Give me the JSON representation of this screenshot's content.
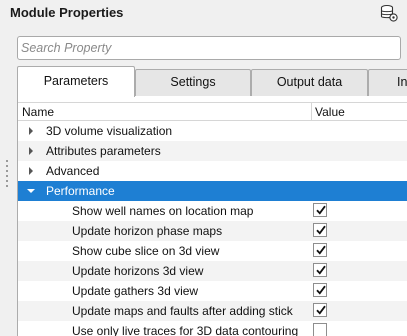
{
  "header": {
    "title": "Module Properties",
    "icon": "database-settings-icon"
  },
  "search": {
    "placeholder": "Search Property",
    "value": ""
  },
  "tabs": [
    {
      "label": "Parameters",
      "active": true
    },
    {
      "label": "Settings",
      "active": false
    },
    {
      "label": "Output data",
      "active": false
    },
    {
      "label": "Inf",
      "active": false
    }
  ],
  "table": {
    "columns": {
      "name": "Name",
      "value": "Value"
    },
    "groups": [
      {
        "label": "3D volume visualization",
        "expanded": false
      },
      {
        "label": "Attributes parameters",
        "expanded": false
      },
      {
        "label": "Advanced",
        "expanded": false
      },
      {
        "label": "Performance",
        "expanded": true,
        "selected": true
      }
    ],
    "performance_items": [
      {
        "label": "Show well names on location map",
        "checked": true
      },
      {
        "label": "Update horizon phase maps",
        "checked": true
      },
      {
        "label": "Show cube slice on 3d view",
        "checked": true
      },
      {
        "label": "Update horizons 3d view",
        "checked": true
      },
      {
        "label": "Update gathers 3d view",
        "checked": true
      },
      {
        "label": "Update maps and faults after adding stick",
        "checked": true
      },
      {
        "label": "Use only live traces for 3D data contouring",
        "checked": false
      }
    ]
  },
  "colors": {
    "selection": "#1e7fd3",
    "background": "#f0f0f0"
  }
}
